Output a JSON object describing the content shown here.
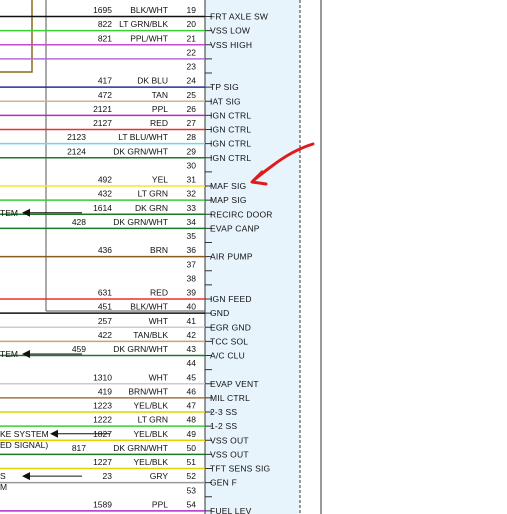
{
  "rows": [
    {
      "pin": "19",
      "circuit": "1695",
      "color_label": "BLK/WHT",
      "function": "FRT AXLE SW",
      "wire_hex": "#111111"
    },
    {
      "pin": "20",
      "circuit": "822",
      "color_label": "LT GRN/BLK",
      "function": "VSS LOW",
      "wire_hex": "#35d135"
    },
    {
      "pin": "21",
      "circuit": "821",
      "color_label": "PPL/WHT",
      "function": "VSS HIGH",
      "wire_hex": "#c54ad0"
    },
    {
      "pin": "22",
      "circuit": "",
      "color_label": "",
      "function": "",
      "wire_hex": "#b46ad8"
    },
    {
      "pin": "23",
      "circuit": "",
      "color_label": "",
      "function": "",
      "wire_hex": ""
    },
    {
      "pin": "24",
      "circuit": "417",
      "color_label": "DK BLU",
      "function": "TP SIG",
      "wire_hex": "#1f2fa5"
    },
    {
      "pin": "25",
      "circuit": "472",
      "color_label": "TAN",
      "function": "IAT SIG",
      "wire_hex": "#d2b48c"
    },
    {
      "pin": "26",
      "circuit": "2121",
      "color_label": "PPL",
      "function": "IGN CTRL",
      "wire_hex": "#b02ccb"
    },
    {
      "pin": "27",
      "circuit": "2127",
      "color_label": "RED",
      "function": "IGN CTRL",
      "wire_hex": "#e8322a"
    },
    {
      "pin": "28",
      "circuit": "2123",
      "color_label": "LT BLU/WHT",
      "function": "IGN CTRL",
      "wire_hex": "#6fd6ef"
    },
    {
      "pin": "29",
      "circuit": "2124",
      "color_label": "DK GRN/WHT",
      "function": "IGN CTRL",
      "wire_hex": "#1a7a2a"
    },
    {
      "pin": "30",
      "circuit": "",
      "color_label": "",
      "function": "",
      "wire_hex": ""
    },
    {
      "pin": "31",
      "circuit": "492",
      "color_label": "YEL",
      "function": "MAF SIG",
      "wire_hex": "#f2ea2a"
    },
    {
      "pin": "32",
      "circuit": "432",
      "color_label": "LT GRN",
      "function": "MAP SIG",
      "wire_hex": "#35d135"
    },
    {
      "pin": "33",
      "circuit": "1614",
      "color_label": "DK GRN",
      "function": "RECIRC DOOR",
      "wire_hex": "#1a7a2a"
    },
    {
      "pin": "34",
      "circuit": "428",
      "color_label": "DK GRN/WHT",
      "function": "EVAP CANP",
      "wire_hex": "#1a7a2a"
    },
    {
      "pin": "35",
      "circuit": "",
      "color_label": "",
      "function": "",
      "wire_hex": ""
    },
    {
      "pin": "36",
      "circuit": "436",
      "color_label": "BRN",
      "function": "AIR PUMP",
      "wire_hex": "#8a5a1e"
    },
    {
      "pin": "37",
      "circuit": "",
      "color_label": "",
      "function": "",
      "wire_hex": ""
    },
    {
      "pin": "38",
      "circuit": "",
      "color_label": "",
      "function": "",
      "wire_hex": ""
    },
    {
      "pin": "39",
      "circuit": "631",
      "color_label": "RED",
      "function": "IGN FEED",
      "wire_hex": "#e8322a"
    },
    {
      "pin": "40",
      "circuit": "451",
      "color_label": "BLK/WHT",
      "function": "GND",
      "wire_hex": "#111111"
    },
    {
      "pin": "41",
      "circuit": "257",
      "color_label": "WHT",
      "function": "EGR GND",
      "wire_hex": "#cccccc"
    },
    {
      "pin": "42",
      "circuit": "422",
      "color_label": "TAN/BLK",
      "function": "TCC SOL",
      "wire_hex": "#c9a36a"
    },
    {
      "pin": "43",
      "circuit": "459",
      "color_label": "DK GRN/WHT",
      "function": "A/C CLU",
      "wire_hex": "#1a7a2a"
    },
    {
      "pin": "44",
      "circuit": "",
      "color_label": "",
      "function": "",
      "wire_hex": ""
    },
    {
      "pin": "45",
      "circuit": "1310",
      "color_label": "WHT",
      "function": "EVAP VENT",
      "wire_hex": "#cccccc"
    },
    {
      "pin": "46",
      "circuit": "419",
      "color_label": "BRN/WHT",
      "function": "MIL CTRL",
      "wire_hex": "#a07840"
    },
    {
      "pin": "47",
      "circuit": "1223",
      "color_label": "YEL/BLK",
      "function": "2-3 SS",
      "wire_hex": "#e0d400"
    },
    {
      "pin": "48",
      "circuit": "1222",
      "color_label": "LT GRN",
      "function": "1-2 SS",
      "wire_hex": "#35d135"
    },
    {
      "pin": "49",
      "circuit": "1827",
      "color_label": "YEL/BLK",
      "function": "VSS OUT",
      "wire_hex": "#e0d400"
    },
    {
      "pin": "50",
      "circuit": "817",
      "color_label": "DK GRN/WHT",
      "function": "VSS OUT",
      "wire_hex": "#1a7a2a"
    },
    {
      "pin": "51",
      "circuit": "1227",
      "color_label": "YEL/BLK",
      "function": "TFT SENS SIG",
      "wire_hex": "#e0d400"
    },
    {
      "pin": "52",
      "circuit": "23",
      "color_label": "GRY",
      "function": "GEN F",
      "wire_hex": "#999999"
    },
    {
      "pin": "53",
      "circuit": "",
      "color_label": "",
      "function": "",
      "wire_hex": ""
    },
    {
      "pin": "54",
      "circuit": "1589",
      "color_label": "PPL",
      "function": "FUEL LEV",
      "wire_hex": "#b02ccb"
    }
  ],
  "left_labels": [
    {
      "text": "TEM",
      "pin": "33"
    },
    {
      "text": "TEM",
      "pin": "43"
    },
    {
      "text": "KE SYSTEM",
      "pin": "49"
    },
    {
      "text": "ED SIGNAL)",
      "pin": "49"
    },
    {
      "text": "S",
      "pin": "52"
    },
    {
      "text": "M",
      "pin": "52"
    }
  ],
  "connector_hex": "#e8f4fb",
  "annotation_hex": "#e01b1b"
}
